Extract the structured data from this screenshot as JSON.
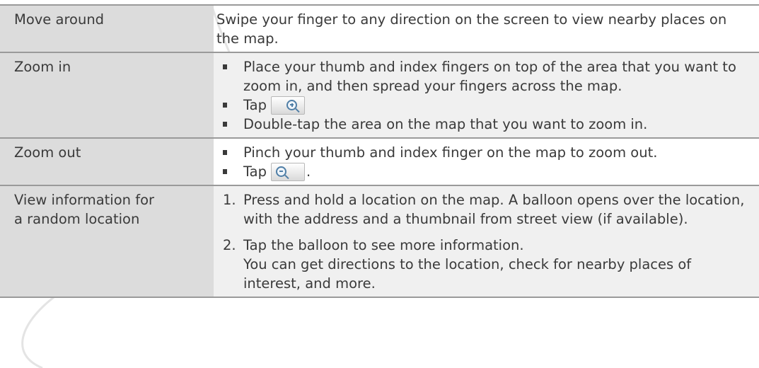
{
  "rows": [
    {
      "gesture": "Move around",
      "description": "Swipe your finger to any direction on the screen to view nearby places on the map."
    },
    {
      "gesture": "Zoom in",
      "bullets": [
        "Place your thumb and index fingers on top of the area that you want to zoom in, and then spread your fingers across the map.",
        "Tap",
        "Double-tap the area on the map that you want to zoom in."
      ],
      "tap_suffix": ""
    },
    {
      "gesture": "Zoom out",
      "bullets": [
        "Pinch your thumb and index finger on the map to zoom out.",
        "Tap"
      ],
      "tap_suffix": "."
    },
    {
      "gesture": "View information for a random location",
      "steps": [
        {
          "num": "1.",
          "text": "Press and hold a location on the map. A balloon opens over the location, with the address and a thumbnail from street view (if available)."
        },
        {
          "num": "2.",
          "text": "Tap the balloon to see more information.",
          "subtext": "You can get directions to the location, check for nearby places of interest, and more."
        }
      ]
    }
  ],
  "icons": {
    "zoom_in": "zoom-in-icon",
    "zoom_out": "zoom-out-icon"
  },
  "colors": {
    "gesture_bg": "#dcdcdc",
    "desc_bg": "#f0f0f0",
    "text": "#3a3a3a",
    "rule": "#9a9a9a",
    "icon": "#4f7ea6"
  }
}
